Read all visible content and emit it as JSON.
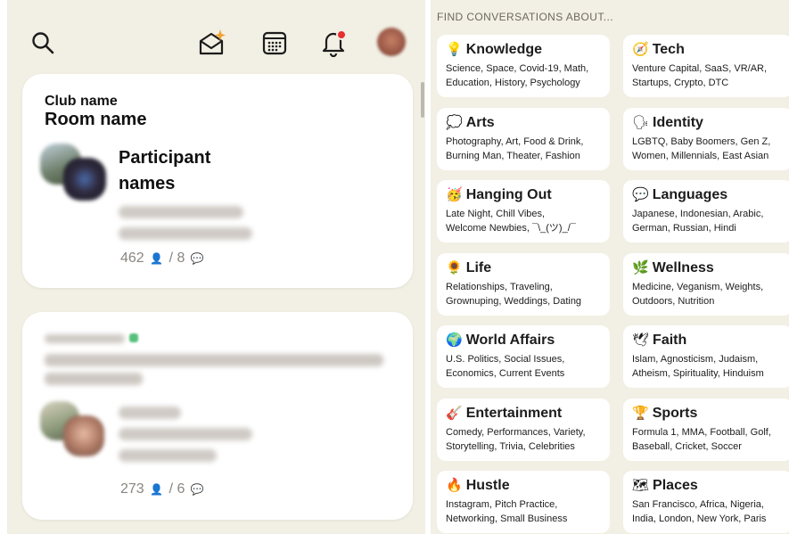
{
  "header": {
    "search_icon": "search-icon",
    "invite_icon": "envelope-sparkle-icon",
    "calendar_icon": "calendar-icon",
    "bell_icon": "bell-icon",
    "profile_icon": "avatar"
  },
  "rooms": [
    {
      "club": "Club name",
      "room": "Room name",
      "participants_label_1": "Participant",
      "participants_label_2": "names",
      "listeners": "462",
      "speakers": "8"
    },
    {
      "listeners": "273",
      "speakers": "6"
    }
  ],
  "topics": {
    "title": "FIND CONVERSATIONS ABOUT...",
    "items": [
      {
        "emoji": "💡",
        "name": "Knowledge",
        "desc": "Science, Space, Covid-19, Math,\nEducation, History, Psychology"
      },
      {
        "emoji": "🧭",
        "name": "Tech",
        "desc": "Venture Capital, SaaS, VR/AR,\nStartups, Crypto, DTC"
      },
      {
        "emoji": "💭",
        "name": "Arts",
        "desc": "Photography, Art, Food & Drink,\nBurning Man, Theater, Fashion"
      },
      {
        "emoji": "🗣",
        "name": "Identity",
        "desc": "LGBTQ, Baby Boomers, Gen Z,\nWomen, Millennials, East Asian"
      },
      {
        "emoji": "🥳",
        "name": "Hanging Out",
        "desc": "Late Night, Chill Vibes,\nWelcome Newbies, ¯\\_(ツ)_/¯"
      },
      {
        "emoji": "💬",
        "name": "Languages",
        "desc": "Japanese, Indonesian, Arabic,\nGerman, Russian, Hindi"
      },
      {
        "emoji": "🌻",
        "name": "Life",
        "desc": "Relationships, Traveling,\nGrownuping, Weddings, Dating"
      },
      {
        "emoji": "🌿",
        "name": "Wellness",
        "desc": "Medicine, Veganism, Weights,\nOutdoors, Nutrition"
      },
      {
        "emoji": "🌍",
        "name": "World Affairs",
        "desc": "U.S. Politics, Social Issues,\nEconomics, Current Events"
      },
      {
        "emoji": "🕊",
        "name": "Faith",
        "desc": "Islam, Agnosticism, Judaism,\nAtheism, Spirituality, Hinduism"
      },
      {
        "emoji": "🎸",
        "name": "Entertainment",
        "desc": "Comedy, Performances, Variety,\nStorytelling, Trivia, Celebrities"
      },
      {
        "emoji": "🏆",
        "name": "Sports",
        "desc": "Formula 1, MMA, Football, Golf,\nBaseball, Cricket, Soccer"
      },
      {
        "emoji": "🔥",
        "name": "Hustle",
        "desc": "Instagram, Pitch Practice,\nNetworking, Small Business"
      },
      {
        "emoji": "🗺",
        "name": "Places",
        "desc": "San Francisco, Africa, Nigeria,\nIndia, London, New York, Paris"
      }
    ]
  }
}
